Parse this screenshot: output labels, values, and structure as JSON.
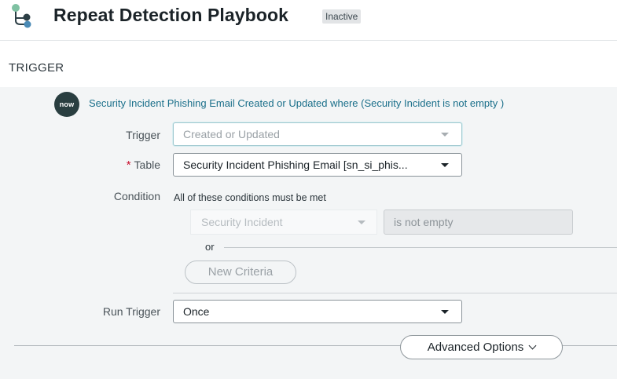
{
  "header": {
    "title": "Repeat Detection Playbook",
    "status_badge": "Inactive",
    "logo_icon": "flow-branch-icon",
    "logo_colors": [
      "#7fc1a2",
      "#4a8ab5",
      "#2d3f46"
    ]
  },
  "section": {
    "label": "TRIGGER"
  },
  "trigger_summary": {
    "icon_text": "now",
    "text": "Security Incident Phishing Email Created or Updated where (Security Incident is not empty )"
  },
  "form": {
    "trigger": {
      "label": "Trigger",
      "value": "Created or Updated"
    },
    "table": {
      "label": "Table",
      "required_mark": "*",
      "value": "Security Incident Phishing Email [sn_si_phis..."
    },
    "condition": {
      "label": "Condition",
      "description": "All of these conditions must be met",
      "field": "Security Incident",
      "operator": "is not empty",
      "or_label": "or",
      "new_criteria_label": "New Criteria"
    },
    "run_trigger": {
      "label": "Run Trigger",
      "value": "Once"
    }
  },
  "advanced_options": {
    "label": "Advanced Options"
  },
  "colors": {
    "accent_link": "#1a6f8a",
    "now_badge_bg": "#293e40",
    "required": "#c8102e"
  }
}
